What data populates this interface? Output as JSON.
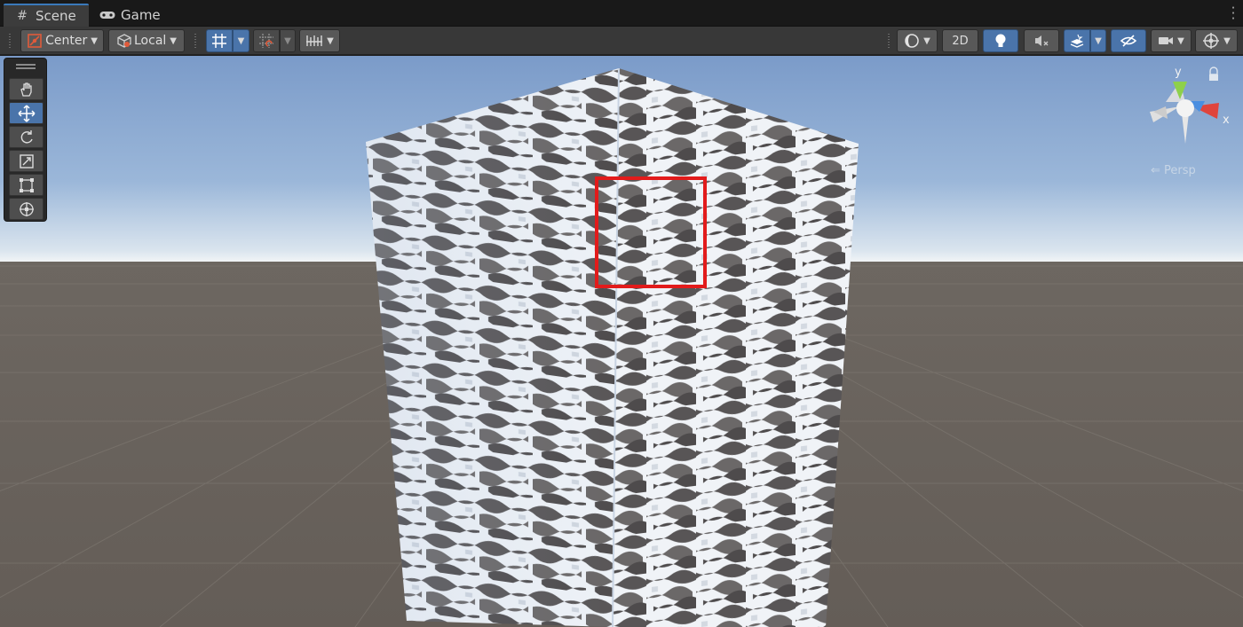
{
  "tabs": [
    {
      "label": "Scene",
      "icon": "hash-icon",
      "active": true
    },
    {
      "label": "Game",
      "icon": "gamepad-icon",
      "active": false
    }
  ],
  "toolbar": {
    "pivot_mode": "Center",
    "pivot_rotation": "Local",
    "mode_2d": "2D"
  },
  "gizmo": {
    "axis_y": "y",
    "axis_x": "x",
    "projection": "Persp"
  },
  "palette_tools": [
    "hand-tool",
    "move-tool",
    "rotate-tool",
    "scale-tool",
    "rect-tool",
    "transform-tool"
  ],
  "colors": {
    "accent": "#4a74aa",
    "highlight": "#e21b1b",
    "axis_x": "#e0443c",
    "axis_y": "#8ed04b",
    "axis_z": "#4a8ee0"
  }
}
